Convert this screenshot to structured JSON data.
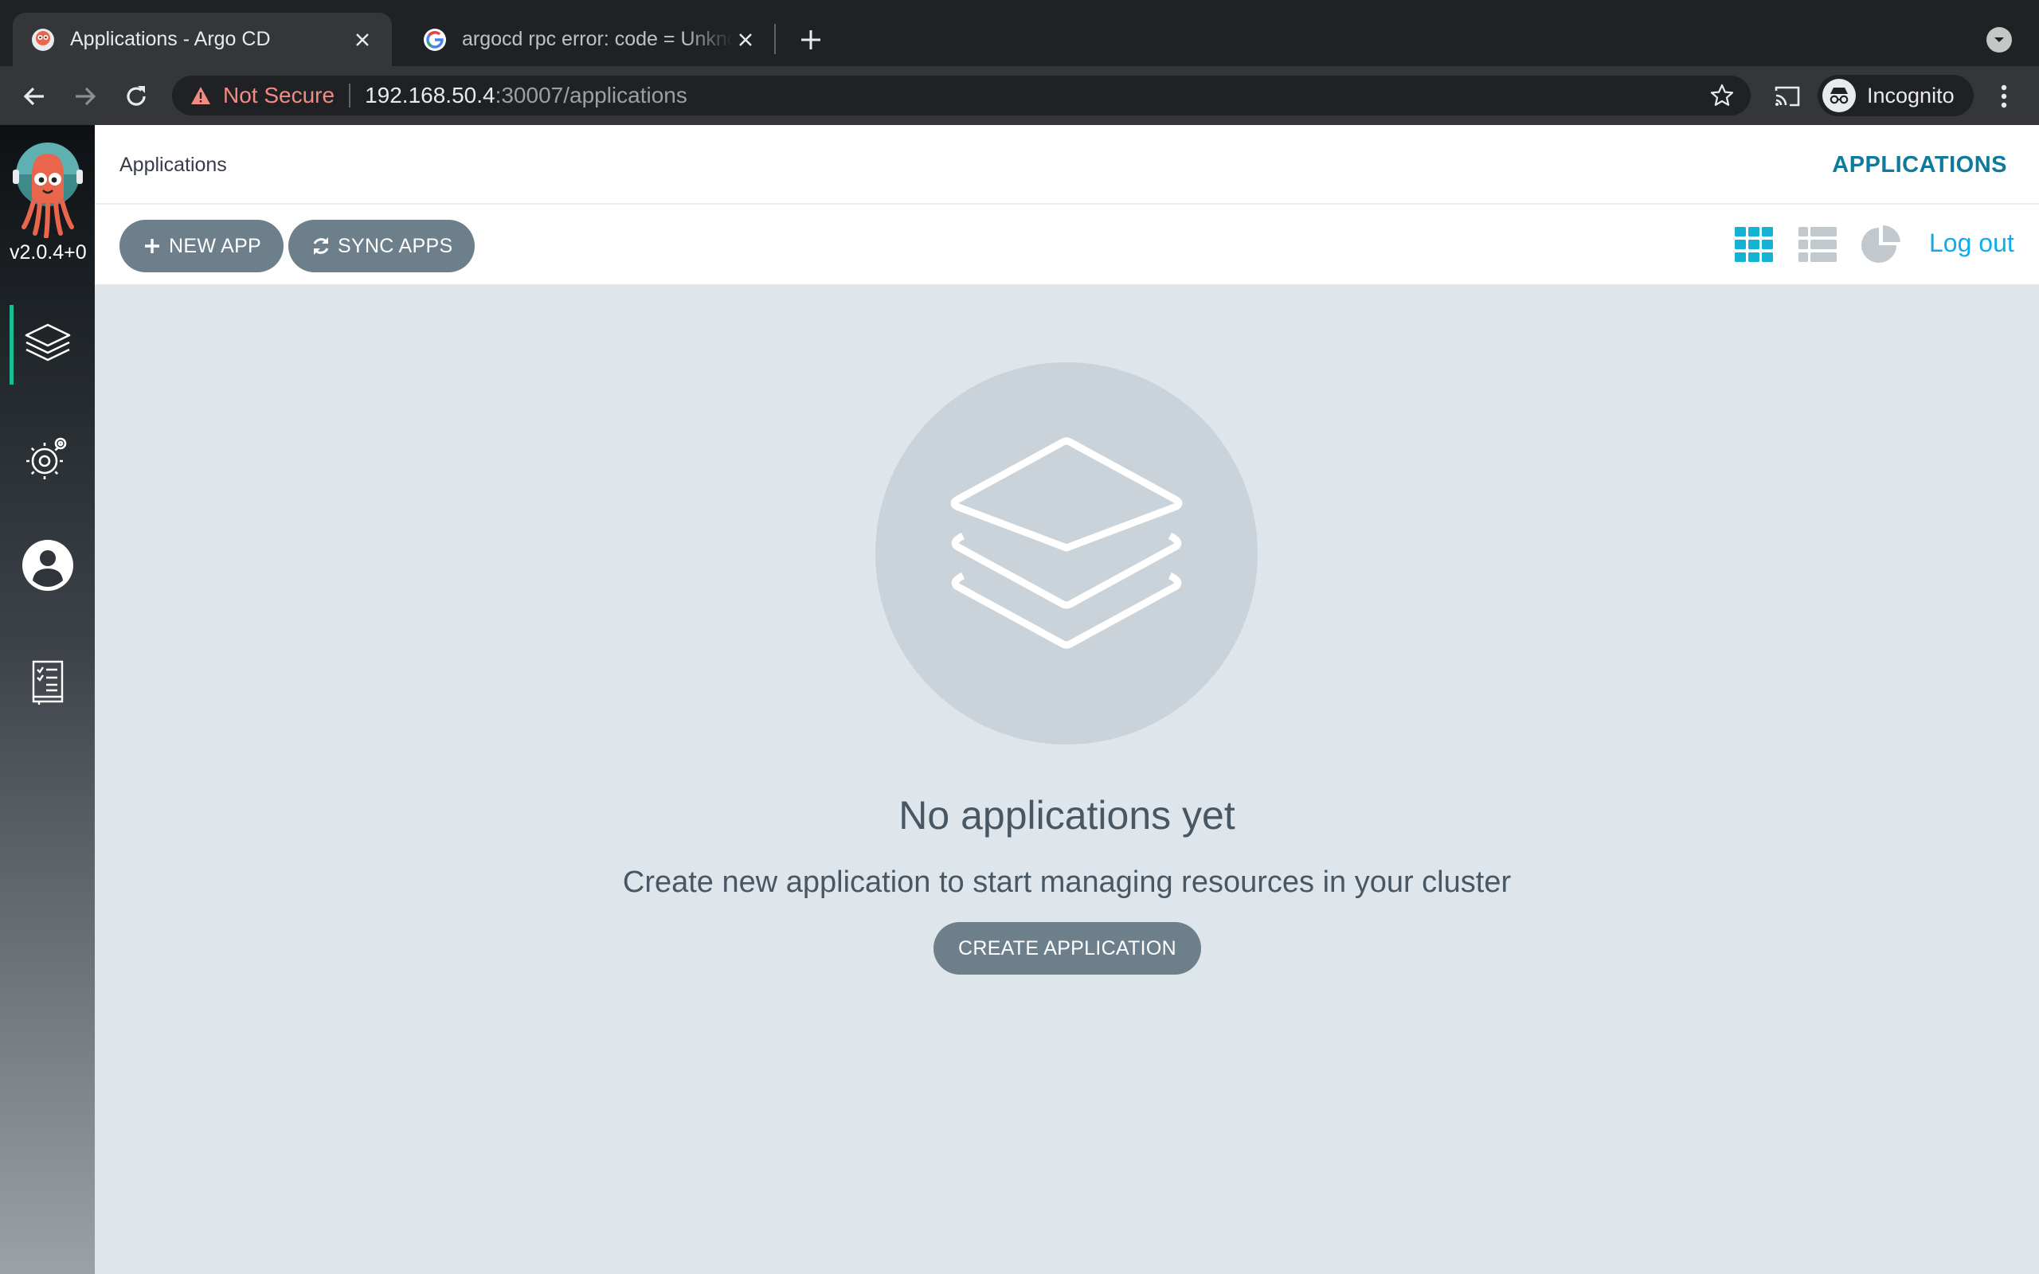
{
  "browser": {
    "tabs": [
      {
        "title": "Applications - Argo CD",
        "favicon": "argo-octopus-icon",
        "active": true
      },
      {
        "title": "argocd rpc error: code = Unknown",
        "favicon": "google-g-icon",
        "active": false
      }
    ],
    "address": {
      "security_label": "Not Secure",
      "host": "192.168.50.4",
      "path": ":30007/applications"
    },
    "profile_label": "Incognito"
  },
  "sidebar": {
    "version": "v2.0.4+0",
    "items": [
      {
        "name": "applications",
        "icon": "layers-icon",
        "active": true
      },
      {
        "name": "settings",
        "icon": "gear-icon",
        "active": false
      },
      {
        "name": "user-info",
        "icon": "user-circle-icon",
        "active": false
      },
      {
        "name": "documentation",
        "icon": "book-icon",
        "active": false
      }
    ]
  },
  "header": {
    "breadcrumb": "Applications",
    "section_title": "APPLICATIONS"
  },
  "actions": {
    "new_app": "NEW APP",
    "sync_apps": "SYNC APPS",
    "logout": "Log out",
    "views": [
      "tiles-view-icon",
      "list-view-icon",
      "summary-pie-icon"
    ],
    "active_view": "tiles-view-icon"
  },
  "empty_state": {
    "title": "No applications yet",
    "subtitle": "Create new application to start managing resources in your cluster",
    "button": "CREATE APPLICATION"
  },
  "colors": {
    "accent": "#0dadea",
    "active_view_icon": "#15b3d3",
    "button_bg": "#6d7f8b",
    "page_bg": "#dee6eb",
    "warning": "#f28b82"
  }
}
